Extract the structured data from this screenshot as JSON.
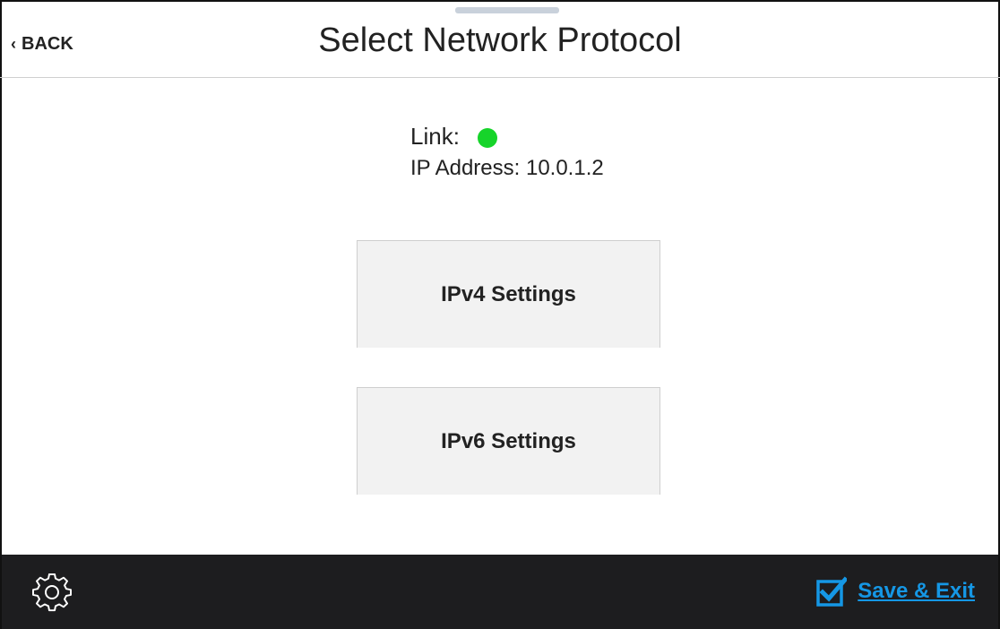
{
  "header": {
    "back_label": "BACK",
    "title": "Select Network Protocol"
  },
  "status": {
    "link_label": "Link:",
    "link_color": "#16d42a",
    "ip_text": "IP Address: 10.0.1.2"
  },
  "buttons": {
    "ipv4_label": "IPv4 Settings",
    "ipv6_label": "IPv6 Settings"
  },
  "footer": {
    "settings_icon": "gear-icon",
    "save_label": "Save & Exit",
    "save_icon": "checkbox-checked-icon",
    "accent_color": "#1597e5"
  }
}
